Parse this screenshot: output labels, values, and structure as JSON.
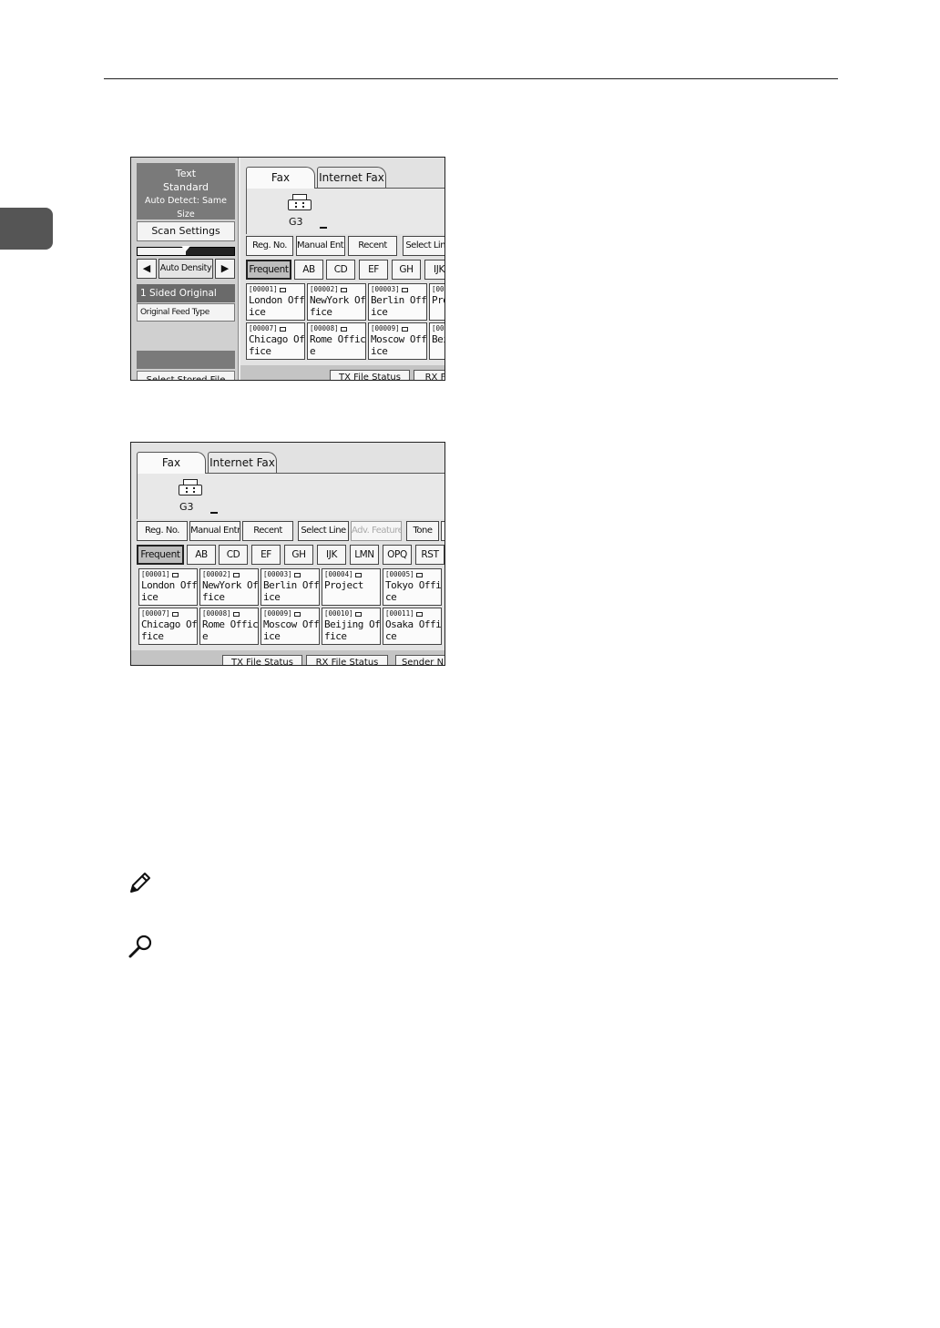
{
  "screen1": {
    "scan_settings": {
      "line1": "Text",
      "line2": "Standard",
      "line3": "Auto Detect: Same Size",
      "button": "Scan Settings"
    },
    "density": {
      "level": 0.5,
      "left_arrow": "◀",
      "label": "Auto Density",
      "right_arrow": "▶"
    },
    "original": {
      "sided": "1 Sided Original",
      "feed_type": "Original Feed Type"
    },
    "stored_file_button": "Select Stored File",
    "tabs": [
      "Fax",
      "Internet Fax"
    ],
    "line_type": "G3",
    "function_buttons": [
      "Reg. No.",
      "Manual Entry",
      "Recent",
      "Select Line"
    ],
    "index_tabs": [
      "Frequent",
      "AB",
      "CD",
      "EF",
      "GH",
      "IJK"
    ],
    "destinations": [
      {
        "code": "[00001]",
        "name": "London Office"
      },
      {
        "code": "[00002]",
        "name": "NewYork Office"
      },
      {
        "code": "[00003]",
        "name": "Berlin Office"
      },
      {
        "code": "[0000",
        "name": "Pro"
      },
      {
        "code": "[00007]",
        "name": "Chicago Office"
      },
      {
        "code": "[00008]",
        "name": "Rome Office"
      },
      {
        "code": "[00009]",
        "name": "Moscow Office"
      },
      {
        "code": "[0001",
        "name": "Beifi"
      }
    ],
    "status_buttons": [
      "TX File Status",
      "RX Fi"
    ]
  },
  "screen2": {
    "tabs": [
      "Fax",
      "Internet Fax"
    ],
    "line_type": "G3",
    "function_buttons": [
      "Reg. No.",
      "Manual Entry",
      "Recent",
      "Select Line",
      "Adv. Features",
      "Tone",
      "P"
    ],
    "index_tabs": [
      "Frequent",
      "AB",
      "CD",
      "EF",
      "GH",
      "IJK",
      "LMN",
      "OPQ",
      "RST"
    ],
    "destinations": [
      {
        "code": "[00001]",
        "name": "London Office"
      },
      {
        "code": "[00002]",
        "name": "NewYork Office"
      },
      {
        "code": "[00003]",
        "name": "Berlin Office"
      },
      {
        "code": "[00004]",
        "name": "Project"
      },
      {
        "code": "[00005]",
        "name": "Tokyo Office"
      },
      {
        "code": "[00007]",
        "name": "Chicago Office"
      },
      {
        "code": "[00008]",
        "name": "Rome Office"
      },
      {
        "code": "[00009]",
        "name": "Moscow Office"
      },
      {
        "code": "[00010]",
        "name": "Beijing Office"
      },
      {
        "code": "[00011]",
        "name": "Osaka Office"
      }
    ],
    "status_buttons": [
      "TX File Status",
      "RX File Status",
      "Sender N"
    ]
  },
  "icons": {
    "note": "pencil-icon",
    "reference": "magnifier-icon"
  }
}
